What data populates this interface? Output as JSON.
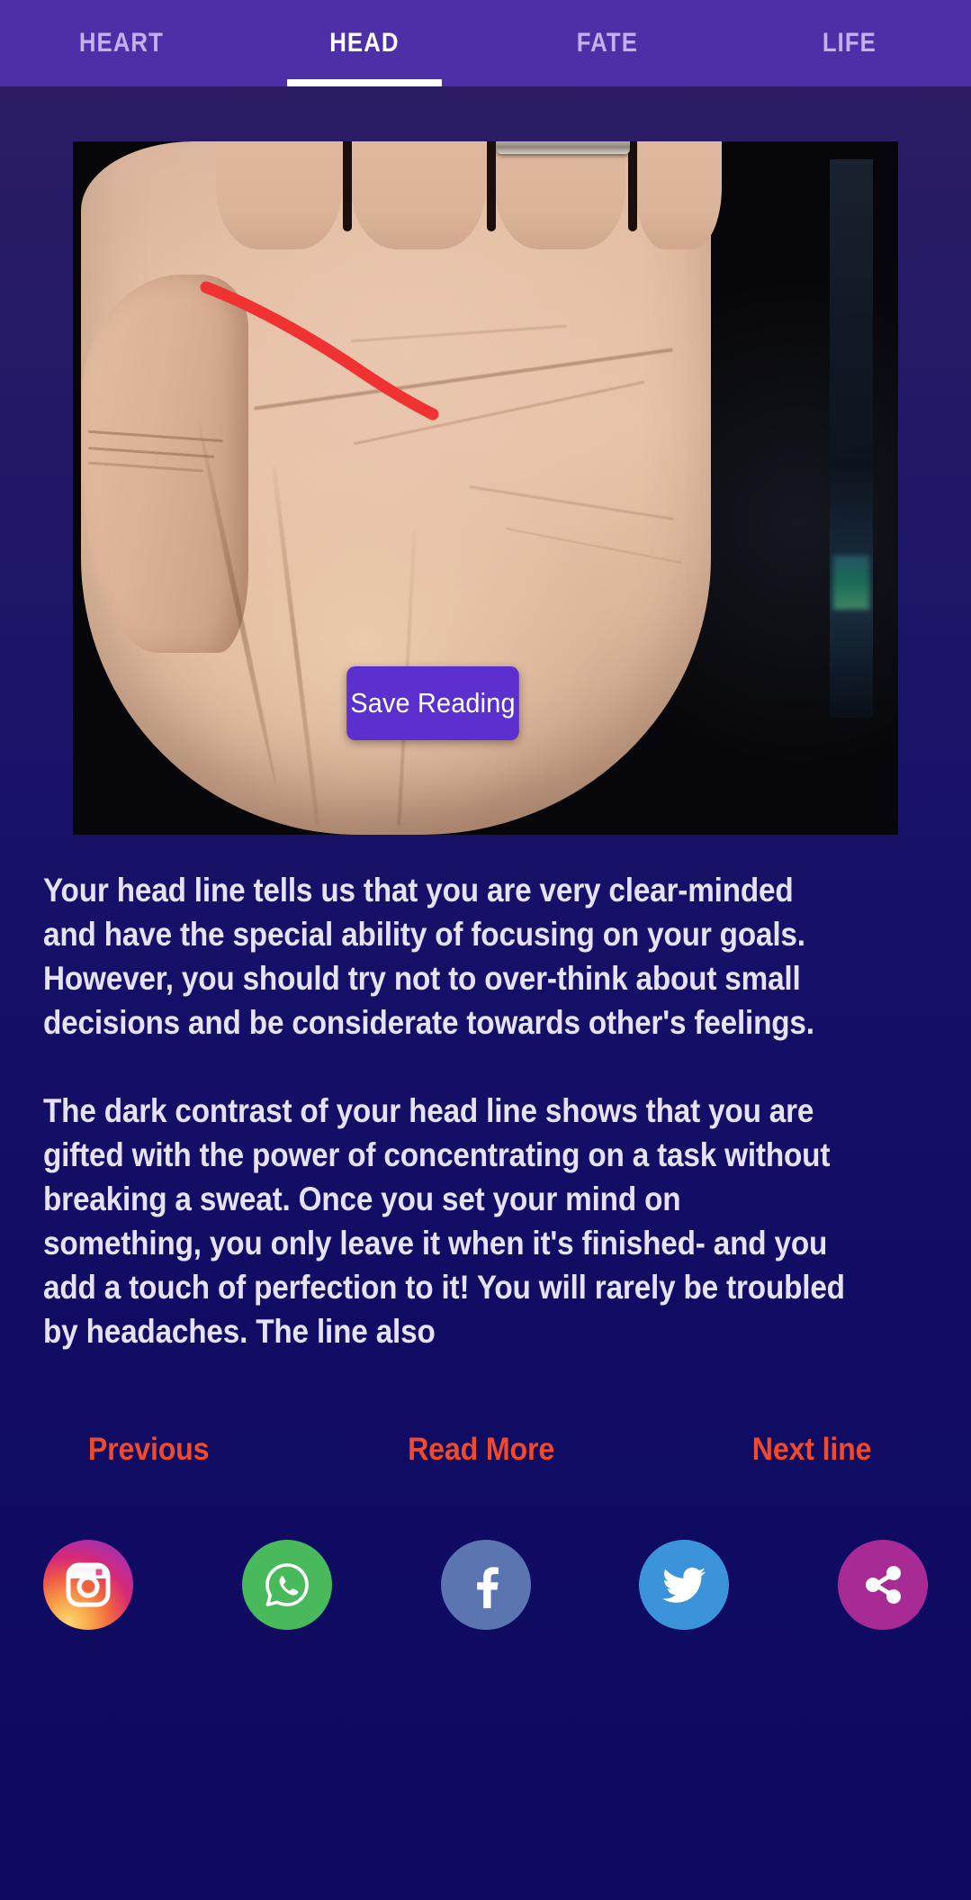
{
  "theme": {
    "tabbar_bg": "#4d2fa8",
    "page_bg_top": "#2e1d64",
    "page_bg_bottom": "#0d0a5f",
    "accent_link": "#f0492b",
    "save_button_bg": "#5b30cf",
    "text_color": "#e6e2f5",
    "headline_highlight": "#f03232"
  },
  "tabs": [
    {
      "label": "HEART",
      "active": false
    },
    {
      "label": "HEAD",
      "active": true
    },
    {
      "label": "FATE",
      "active": false
    },
    {
      "label": "LIFE",
      "active": false
    }
  ],
  "photo": {
    "alt": "palm-photo-with-head-line-highlighted",
    "overlay_line": "head-line"
  },
  "save_button": {
    "label": "Save Reading"
  },
  "reading": {
    "paragraph_1": "Your head line tells us that you are very clear-minded and have the special ability of focusing on your goals. However, you should try not to over-think about small decisions and be considerate towards other's feelings.",
    "paragraph_2": "The dark contrast of your head line shows that you are gifted with the power of concentrating on a task without breaking a sweat. Once you set your mind on something, you only leave it when it's finished- and you add a touch of perfection to it! You will rarely be troubled by headaches. The line also"
  },
  "nav_links": {
    "previous": "Previous",
    "read_more": "Read More",
    "next": "Next line"
  },
  "socials": [
    {
      "name": "instagram",
      "color": "#d62976"
    },
    {
      "name": "whatsapp",
      "color": "#49ba5b"
    },
    {
      "name": "facebook",
      "color": "#5a75b0"
    },
    {
      "name": "twitter",
      "color": "#3b94d9"
    },
    {
      "name": "share",
      "color": "#a82a95"
    }
  ]
}
